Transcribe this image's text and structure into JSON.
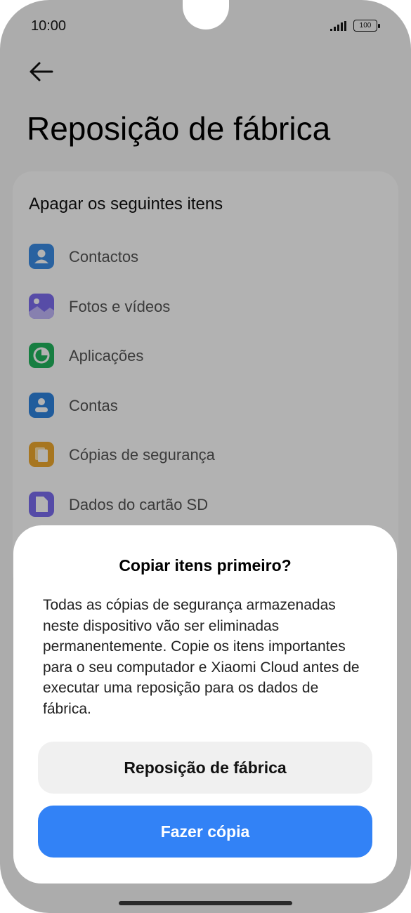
{
  "status_bar": {
    "time": "10:00",
    "battery": "100"
  },
  "page": {
    "title": "Reposição de fábrica"
  },
  "erase_section": {
    "heading": "Apagar os seguintes itens",
    "items": [
      {
        "label": "Contactos",
        "icon": "contacts-icon",
        "color": "#3b8de6"
      },
      {
        "label": "Fotos e vídeos",
        "icon": "gallery-icon",
        "color": "#7d6ef0"
      },
      {
        "label": "Aplicações",
        "icon": "apps-pie-icon",
        "color": "#21b55e"
      },
      {
        "label": "Contas",
        "icon": "account-icon",
        "color": "#2f84e0"
      },
      {
        "label": "Cópias de segurança",
        "icon": "backup-icon",
        "color": "#f0a92e"
      },
      {
        "label": "Dados do cartão SD",
        "icon": "sd-card-icon",
        "color": "#7a6cf0"
      }
    ]
  },
  "dialog": {
    "title": "Copiar itens primeiro?",
    "message": "Todas as cópias de segurança armazenadas neste dispositivo vão ser eliminadas permanentemente. Copie os itens importantes para o seu computador e Xiaomi Cloud antes de executar uma reposição para os dados de fábrica.",
    "secondary_button": "Reposição de fábrica",
    "primary_button": "Fazer cópia"
  },
  "colors": {
    "accent": "#3282f6",
    "scrim": "rgba(0,0,0,0.30)"
  }
}
